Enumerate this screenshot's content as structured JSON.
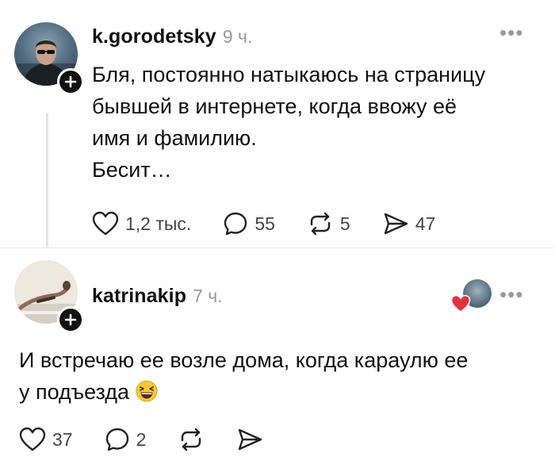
{
  "posts": [
    {
      "username": "k.gorodetsky",
      "time": "9 ч.",
      "text_lines": [
        "Бля, постоянно натыкаюсь на страницу",
        "бывшей в интернете, когда ввожу её",
        "имя и фамилию.",
        "Бесит…"
      ],
      "actions": {
        "likes": "1,2 тыс.",
        "comments": "55",
        "reposts": "5",
        "shares": "47"
      }
    },
    {
      "username": "katrinakip",
      "time": "7 ч.",
      "text_lines": [
        "И встречаю ее возле дома, когда караулю ее",
        "у подъезда"
      ],
      "actions": {
        "likes": "37",
        "comments": "2"
      }
    }
  ],
  "icons": {
    "menu": "more-dots-icon",
    "like": "heart-outline-icon",
    "comment": "comment-bubble-icon",
    "repost": "repost-arrows-icon",
    "share": "send-arrow-icon",
    "follow": "plus-icon",
    "reaction": "laughing-face-emoji"
  },
  "colors": {
    "text": "#111111",
    "muted": "#9a9a9a",
    "heart_red": "#e0313f",
    "emoji_yellow": "#f7c934"
  }
}
